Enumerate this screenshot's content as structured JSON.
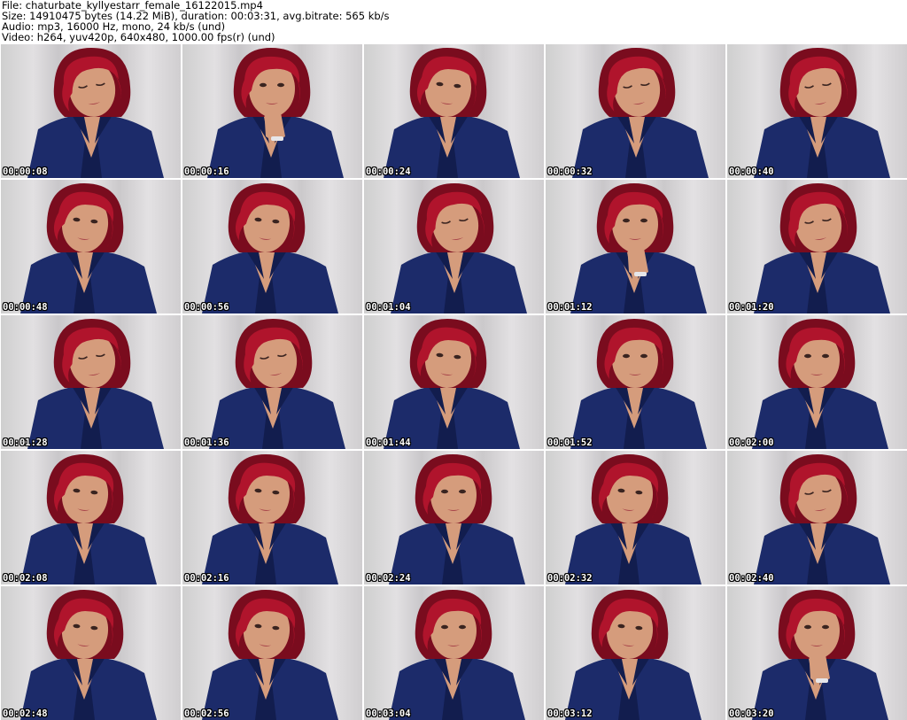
{
  "header": {
    "file_line": "File: chaturbate_kyllyestarr_female_16122015.mp4",
    "size_line": "Size: 14910475 bytes (14.22 MiB), duration: 00:03:31, avg.bitrate: 565 kb/s",
    "audio_line": "Audio: mp3, 16000 Hz, mono, 24 kb/s (und)",
    "video_line": "Video: h264, yuv420p, 640x480, 1000.00 fps(r) (und)"
  },
  "thumbnails": [
    {
      "timestamp": "00:00:08",
      "pose": "down"
    },
    {
      "timestamp": "00:00:16",
      "pose": "hand"
    },
    {
      "timestamp": "00:00:24",
      "pose": "left"
    },
    {
      "timestamp": "00:00:32",
      "pose": "down"
    },
    {
      "timestamp": "00:00:40",
      "pose": "down"
    },
    {
      "timestamp": "00:00:48",
      "pose": "left"
    },
    {
      "timestamp": "00:00:56",
      "pose": "left"
    },
    {
      "timestamp": "00:01:04",
      "pose": "down"
    },
    {
      "timestamp": "00:01:12",
      "pose": "hand"
    },
    {
      "timestamp": "00:01:20",
      "pose": "down"
    },
    {
      "timestamp": "00:01:28",
      "pose": "down"
    },
    {
      "timestamp": "00:01:36",
      "pose": "down"
    },
    {
      "timestamp": "00:01:44",
      "pose": "left"
    },
    {
      "timestamp": "00:01:52",
      "pose": "front"
    },
    {
      "timestamp": "00:02:00",
      "pose": "front"
    },
    {
      "timestamp": "00:02:08",
      "pose": "left"
    },
    {
      "timestamp": "00:02:16",
      "pose": "left"
    },
    {
      "timestamp": "00:02:24",
      "pose": "front"
    },
    {
      "timestamp": "00:02:32",
      "pose": "left"
    },
    {
      "timestamp": "00:02:40",
      "pose": "down"
    },
    {
      "timestamp": "00:02:48",
      "pose": "left"
    },
    {
      "timestamp": "00:02:56",
      "pose": "left"
    },
    {
      "timestamp": "00:03:04",
      "pose": "front"
    },
    {
      "timestamp": "00:03:12",
      "pose": "left"
    },
    {
      "timestamp": "00:03:20",
      "pose": "hand"
    }
  ],
  "colors": {
    "hair": "#b0142c",
    "hair_dark": "#7a0c1e",
    "skin": "#d59c7c",
    "shirt": "#1c2b6a",
    "shirt_dark": "#121d4e",
    "background": "#d4d2d4"
  }
}
